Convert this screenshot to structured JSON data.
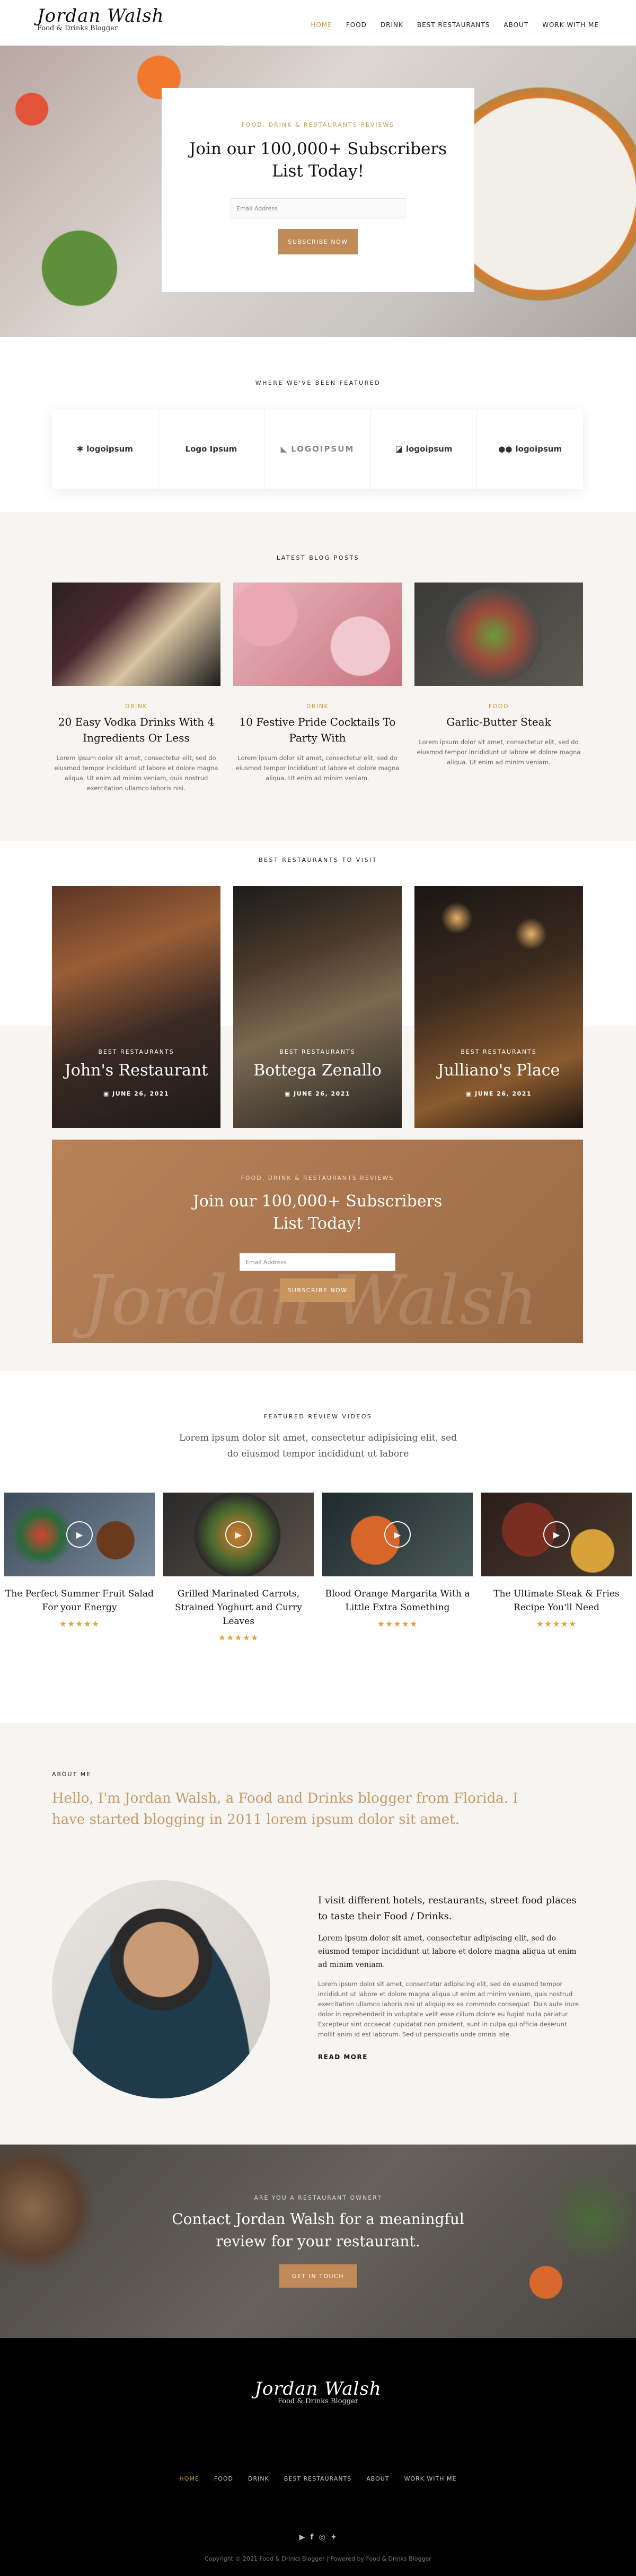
{
  "header": {
    "logo_name": "Jordan Walsh",
    "logo_sub": "Food & Drinks Blogger",
    "nav": [
      "HOME",
      "FOOD",
      "DRINK",
      "BEST RESTAURANTS",
      "ABOUT",
      "WORK WITH ME"
    ]
  },
  "hero": {
    "overline": "FOOD, DRINK & RESTAURANTS REVIEWS",
    "title_line1": "Join our 100,000+ Subscribers",
    "title_line2": "List Today!",
    "email_placeholder": "Email Address",
    "button": "SUBSCRIBE NOW"
  },
  "featured": {
    "title": "WHERE WE'VE BEEN FEATURED",
    "logos": [
      "logoipsum",
      "Logo Ipsum",
      "LOGOIPSUM",
      "logoipsum",
      "logoipsum"
    ]
  },
  "blog": {
    "title": "LATEST BLOG POSTS",
    "posts": [
      {
        "cat": "DRINK",
        "title": "20 Easy Vodka Drinks With 4 Ingredients Or Less",
        "excerpt": "Lorem ipsum dolor sit amet, consectetur elit, sed do eiusmod tempor incididunt ut labore et dolore magna aliqua. Ut enim ad minim veniam, quis nostrud exercitation ullamco laboris nisi."
      },
      {
        "cat": "DRINK",
        "title": "10 Festive Pride Cocktails To Party With",
        "excerpt": "Lorem ipsum dolor sit amet, consectetur elit, sed do eiusmod tempor incididunt ut labore et dolore magna aliqua. Ut enim ad minim veniam."
      },
      {
        "cat": "FOOD",
        "title": "Garlic-Butter Steak",
        "excerpt": "Lorem ipsum dolor sit amet, consectetur elit, sed do eiusmod tempor incididunt ut labore et dolore magna aliqua. Ut enim ad minim veniam."
      }
    ]
  },
  "restaurants": {
    "title": "BEST RESTAURANTS TO VISIT",
    "items": [
      {
        "sub": "BEST RESTAURANTS",
        "name": "John's Restaurant",
        "date": "JUNE 26, 2021"
      },
      {
        "sub": "BEST RESTAURANTS",
        "name": "Bottega Zenallo",
        "date": "JUNE 26, 2021"
      },
      {
        "sub": "BEST RESTAURANTS",
        "name": "Julliano's Place",
        "date": "JUNE 26, 2021"
      }
    ]
  },
  "subscribe2": {
    "overline": "FOOD, DRINK & RESTAURANTS REVIEWS",
    "title_line1": "Join our 100,000+ Subscribers",
    "title_line2": "List Today!",
    "email_placeholder": "Email Address",
    "button": "SUBSCRIBE NOW",
    "watermark": "Jordan Walsh"
  },
  "videos": {
    "title": "FEATURED REVIEW VIDEOS",
    "intro_line1": "Lorem ipsum dolor sit amet, consectetur adipisicing elit, sed",
    "intro_line2": "do eiusmod tempor incididunt ut labore",
    "items": [
      {
        "title": "The Perfect Summer Fruit Salad For your Energy",
        "stars": "★★★★★"
      },
      {
        "title": "Grilled Marinated Carrots, Strained Yoghurt and Curry Leaves",
        "stars": "★★★★★"
      },
      {
        "title": "Blood Orange Margarita With a Little Extra Something",
        "stars": "★★★★★"
      },
      {
        "title": "The Ultimate Steak & Fries Recipe You'll Need",
        "stars": "★★★★★"
      }
    ]
  },
  "about": {
    "overline": "ABOUT ME",
    "heading_line1": "Hello, I'm Jordan Walsh, a Food and Drinks blogger from Florida. I",
    "heading_line2": "have started blogging in 2011 lorem ipsum dolor sit amet.",
    "lead": "I visit different hotels, restaurants, street food places to taste their Food / Drinks.",
    "para1": "Lorem ipsum dolor sit amet, consectetur adipiscing elit, sed do eiusmod tempor incididunt ut labore et dolore magna aliqua ut enim ad minim veniam.",
    "para2": "Lorem ipsum dolor sit amet, consectetur adipiscing elit, sed do eiusmod tempor incididunt ut labore et dolore magna aliqua ut enim ad minim veniam, quis nostrud exercitation ullamco laboris nisi ut aliquip ex ea commodo consequat. Duis aute irure dolor in reprehenderit in voluptate velit esse cillum dolore eu fugiat nulla pariatur. Excepteur sint occaecat cupidatat non proident, sunt in culpa qui officia deserunt mollit anim id est laborum. Sed ut perspiciatis unde omnis iste.",
    "read_more": "READ MORE"
  },
  "cta": {
    "overline": "ARE YOU A RESTAURANT OWNER?",
    "line1": "Contact Jordan Walsh for a meaningful",
    "line2": "review for your restaurant.",
    "button": "GET IN TOUCH"
  },
  "footer": {
    "logo_name": "Jordan Walsh",
    "logo_sub": "Food & Drinks Blogger",
    "nav": [
      "HOME",
      "FOOD",
      "DRINK",
      "BEST RESTAURANTS",
      "ABOUT",
      "WORK WITH ME"
    ],
    "social": [
      "youtube-icon",
      "facebook-icon",
      "instagram-icon",
      "twitter-icon"
    ],
    "copyright": "Copyright © 2021 Food & Drinks Blogger | Powered by Food & Drinks Blogger"
  },
  "colors": {
    "gold": "#c08b58",
    "accent": "#c59a3a",
    "dark": "#000000"
  }
}
